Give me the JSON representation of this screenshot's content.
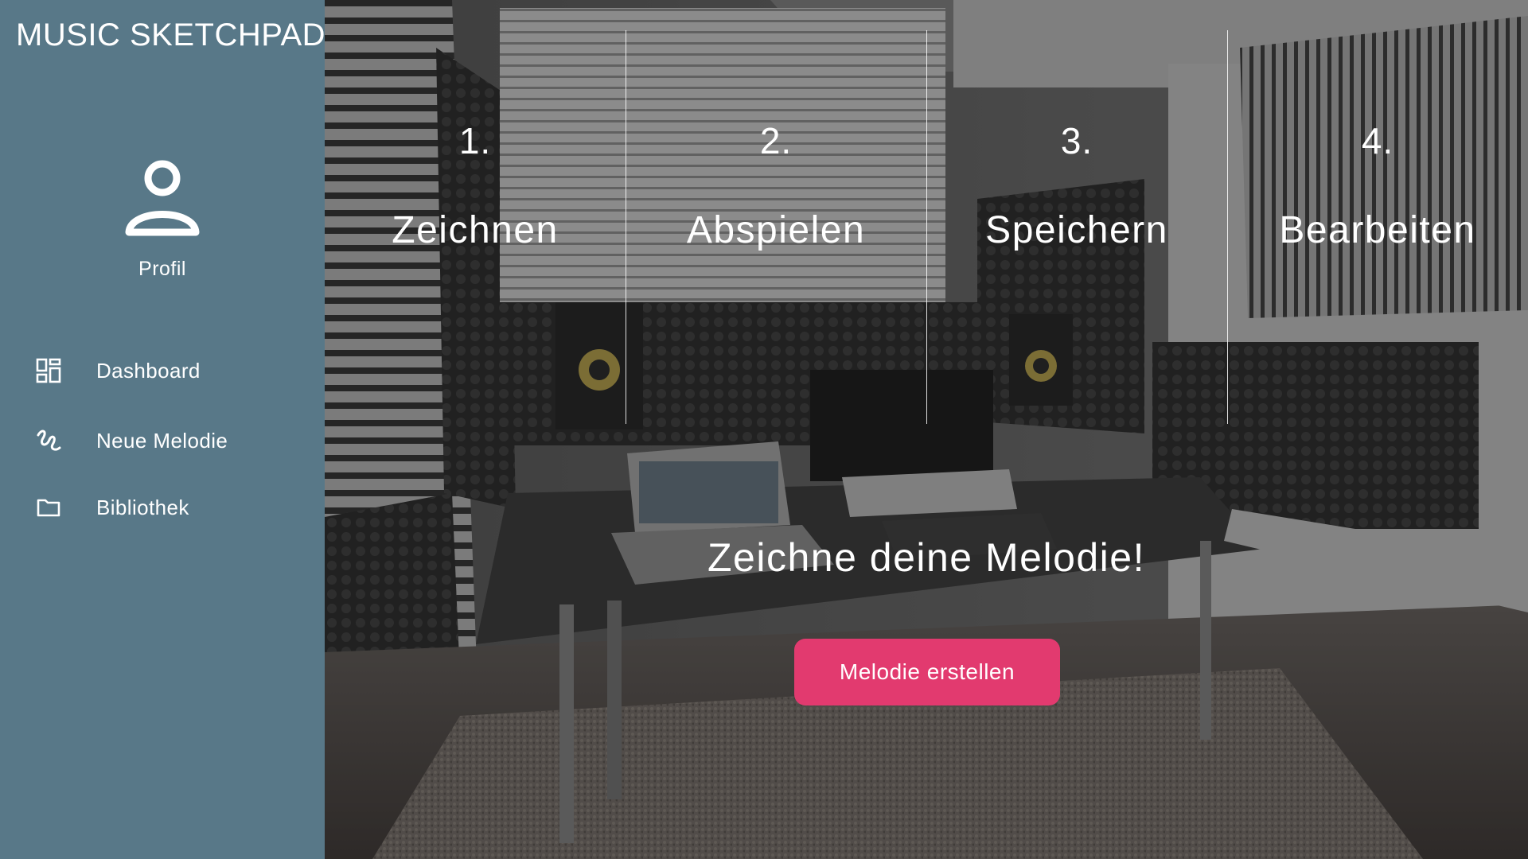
{
  "app": {
    "title": "MUSIC SKETCHPAD"
  },
  "sidebar": {
    "background_color": "#587888",
    "profile": {
      "icon": "user-icon",
      "label": "Profil"
    },
    "nav": [
      {
        "icon": "dashboard-icon",
        "label": "Dashboard"
      },
      {
        "icon": "squiggle-icon",
        "label": "Neue Melodie"
      },
      {
        "icon": "folder-icon",
        "label": "Bibliothek"
      }
    ]
  },
  "hero": {
    "background": "music-studio-photo",
    "steps": [
      {
        "number": "1.",
        "label": "Zeichnen"
      },
      {
        "number": "2.",
        "label": "Abspielen"
      },
      {
        "number": "3.",
        "label": "Speichern"
      },
      {
        "number": "4.",
        "label": "Bearbeiten"
      }
    ],
    "title": "Zeichne deine Melodie!",
    "cta_label": "Melodie erstellen",
    "cta_color": "#e23a6f"
  }
}
